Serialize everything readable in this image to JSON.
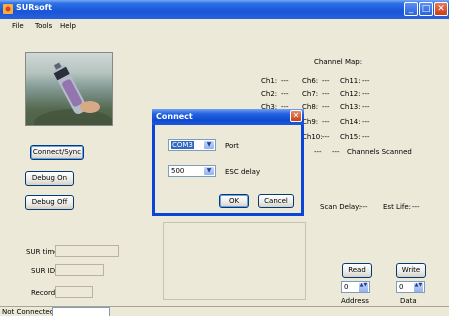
{
  "window": {
    "title": "SURsoft",
    "min": "_",
    "max": "□",
    "close": "✕"
  },
  "menu": [
    "File",
    "Tools",
    "Help"
  ],
  "buttons": {
    "connect": "Connect/Sync",
    "debug_on": "Debug On",
    "debug_off": "Debug Off",
    "read": "Read",
    "write": "Write"
  },
  "channel_map": {
    "title": "Channel Map:",
    "rows": [
      [
        {
          "label": "Ch1:",
          "value": "---"
        },
        {
          "label": "Ch6:",
          "value": "---"
        },
        {
          "label": "Ch11:",
          "value": "---"
        }
      ],
      [
        {
          "label": "Ch2:",
          "value": "---"
        },
        {
          "label": "Ch7:",
          "value": "---"
        },
        {
          "label": "Ch12:",
          "value": "---"
        }
      ],
      [
        {
          "label": "Ch3:",
          "value": "---"
        },
        {
          "label": "Ch8:",
          "value": "---"
        },
        {
          "label": "Ch13:",
          "value": "---"
        }
      ],
      [
        {
          "label": "",
          "value": ""
        },
        {
          "label": "Ch9:",
          "value": "---"
        },
        {
          "label": "Ch14:",
          "value": "---"
        }
      ],
      [
        {
          "label": "",
          "value": ""
        },
        {
          "label": "Ch10:",
          "value": "---"
        },
        {
          "label": "Ch15:",
          "value": "---"
        }
      ]
    ],
    "scanned_value_a": "---",
    "scanned_value_b": "---",
    "scanned_label": "Channels Scanned"
  },
  "scan": {
    "delay_label": "Scan Delay:",
    "delay_value": "---",
    "life_label": "Est Life:",
    "life_value": "---"
  },
  "fields": {
    "sur_time": "SUR time:",
    "sur_id": "SUR ID:",
    "records": "Records:"
  },
  "address": {
    "value": "0",
    "label": "Address"
  },
  "data_field": {
    "value": "0",
    "label": "Data"
  },
  "status": {
    "text": "Not Connected"
  },
  "dialog": {
    "title": "Connect",
    "close": "✕",
    "port_value": "COM3",
    "port_label": "Port",
    "esc_value": "500",
    "esc_label": "ESC delay",
    "ok": "OK",
    "cancel": "Cancel"
  },
  "icons": {
    "dropdown": "▼",
    "spin": "▲▼"
  }
}
